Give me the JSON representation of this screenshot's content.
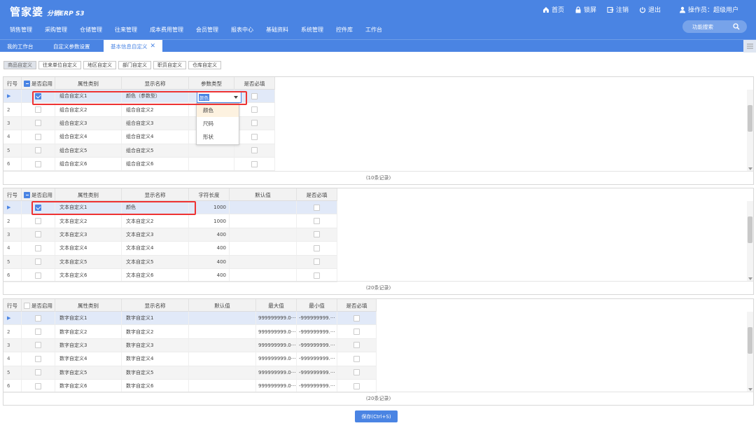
{
  "app": {
    "logo": "管家婆",
    "logo_sub": "分销ERP S3"
  },
  "topbar": {
    "home": "首页",
    "lock": "锁屏",
    "logout": "注销",
    "exit": "退出",
    "operator": "操作员：超级用户"
  },
  "menu": [
    "销售管理",
    "采购管理",
    "仓储管理",
    "往来管理",
    "成本费用管理",
    "会员管理",
    "报表中心",
    "基础资料",
    "系统管理",
    "控件库",
    "工作台"
  ],
  "search": {
    "placeholder": "功能搜索"
  },
  "tabs": [
    {
      "label": "我的工作台"
    },
    {
      "label": "自定义参数设置"
    },
    {
      "label": "基本信息自定义"
    }
  ],
  "subtabs": [
    "商品自定义",
    "往来单位自定义",
    "地区自定义",
    "部门自定义",
    "职员自定义",
    "仓库自定义"
  ],
  "grid1": {
    "headers": [
      "行号",
      "是否启用",
      "属性类别",
      "显示名称",
      "参数类型",
      "是否必填"
    ],
    "rows": [
      {
        "rn": "▶",
        "enabled": true,
        "cat": "组合自定义1",
        "name": "颜色（参数型）",
        "ptype": "颜色"
      },
      {
        "rn": "2",
        "enabled": false,
        "cat": "组合自定义2",
        "name": "组合自定义2",
        "ptype": ""
      },
      {
        "rn": "3",
        "enabled": false,
        "cat": "组合自定义3",
        "name": "组合自定义3",
        "ptype": ""
      },
      {
        "rn": "4",
        "enabled": false,
        "cat": "组合自定义4",
        "name": "组合自定义4",
        "ptype": ""
      },
      {
        "rn": "5",
        "enabled": false,
        "cat": "组合自定义5",
        "name": "组合自定义5",
        "ptype": ""
      },
      {
        "rn": "6",
        "enabled": false,
        "cat": "组合自定义6",
        "name": "组合自定义6",
        "ptype": ""
      }
    ],
    "footer": "(10条记录)",
    "dropdown_options": [
      "颜色",
      "尺码",
      "形状"
    ]
  },
  "grid2": {
    "headers": [
      "行号",
      "是否启用",
      "属性类别",
      "显示名称",
      "字符长度",
      "默认值",
      "是否必填"
    ],
    "rows": [
      {
        "rn": "▶",
        "enabled": true,
        "cat": "文本自定义1",
        "name": "颜色",
        "len": "1000"
      },
      {
        "rn": "2",
        "enabled": false,
        "cat": "文本自定义2",
        "name": "文本自定义2",
        "len": "1000"
      },
      {
        "rn": "3",
        "enabled": false,
        "cat": "文本自定义3",
        "name": "文本自定义3",
        "len": "400"
      },
      {
        "rn": "4",
        "enabled": false,
        "cat": "文本自定义4",
        "name": "文本自定义4",
        "len": "400"
      },
      {
        "rn": "5",
        "enabled": false,
        "cat": "文本自定义5",
        "name": "文本自定义5",
        "len": "400"
      },
      {
        "rn": "6",
        "enabled": false,
        "cat": "文本自定义6",
        "name": "文本自定义6",
        "len": "400"
      }
    ],
    "footer": "(20条记录)"
  },
  "grid3": {
    "headers": [
      "行号",
      "是否启用",
      "属性类别",
      "显示名称",
      "默认值",
      "最大值",
      "最小值",
      "是否必填"
    ],
    "rows": [
      {
        "rn": "▶",
        "cat": "数字自定义1",
        "name": "数字自定义1",
        "max": "999999999.0···",
        "min": "-999999999.···"
      },
      {
        "rn": "2",
        "cat": "数字自定义2",
        "name": "数字自定义2",
        "max": "999999999.0···",
        "min": "-999999999.···"
      },
      {
        "rn": "3",
        "cat": "数字自定义3",
        "name": "数字自定义3",
        "max": "999999999.0···",
        "min": "-999999999.···"
      },
      {
        "rn": "4",
        "cat": "数字自定义4",
        "name": "数字自定义4",
        "max": "999999999.0···",
        "min": "-999999999.···"
      },
      {
        "rn": "5",
        "cat": "数字自定义5",
        "name": "数字自定义5",
        "max": "999999999.0···",
        "min": "-999999999.···"
      },
      {
        "rn": "6",
        "cat": "数字自定义6",
        "name": "数字自定义6",
        "max": "999999999.0···",
        "min": "-999999999.···"
      }
    ],
    "footer": "(20条记录)"
  },
  "save": {
    "label": "保存(Ctrl+S)"
  },
  "colors": {
    "primary": "#4a84e3",
    "highlight": "#e33333"
  }
}
